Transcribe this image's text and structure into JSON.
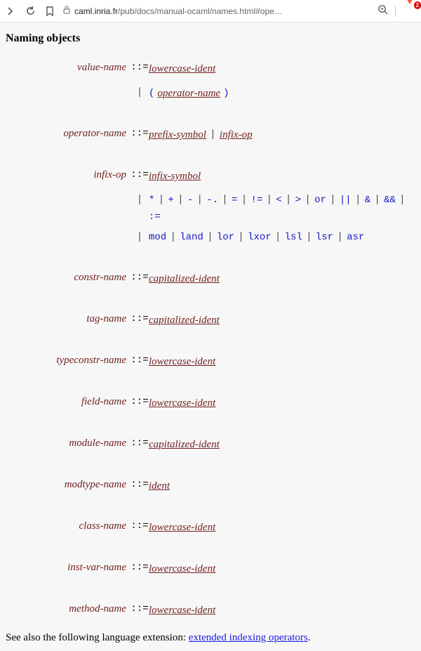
{
  "browser": {
    "url_domain": "caml.inria.fr",
    "url_path": "/pub/docs/manual-ocaml/names.html#ope…",
    "badge": "2"
  },
  "heading": "Naming objects",
  "rules": {
    "value_name": {
      "lhs": "value-name",
      "rhs": [
        "lowercase-ident"
      ]
    },
    "value_name_alt": {
      "paren_open": "(",
      "op": "operator-name",
      "paren_close": ")"
    },
    "operator_name": {
      "lhs": "operator-name",
      "rhs_a": "prefix-symbol",
      "rhs_b": "infix-op"
    },
    "infix_op": {
      "lhs": "infix-op",
      "rhs": "infix-symbol"
    },
    "infix_ops_1": [
      "*",
      "+",
      "-",
      "-.",
      "=",
      "!=",
      "<",
      ">",
      "or",
      "||",
      "&",
      "&&",
      ":="
    ],
    "infix_ops_2": [
      "mod",
      "land",
      "lor",
      "lxor",
      "lsl",
      "lsr",
      "asr"
    ],
    "constr_name": {
      "lhs": "constr-name",
      "rhs": "capitalized-ident"
    },
    "tag_name": {
      "lhs": "tag-name",
      "rhs": "capitalized-ident"
    },
    "typeconstr_name": {
      "lhs": "typeconstr-name",
      "rhs": "lowercase-ident"
    },
    "field_name": {
      "lhs": "field-name",
      "rhs": "lowercase-ident"
    },
    "module_name": {
      "lhs": "module-name",
      "rhs": "capitalized-ident"
    },
    "modtype_name": {
      "lhs": "modtype-name",
      "rhs": "ident"
    },
    "class_name": {
      "lhs": "class-name",
      "rhs": "lowercase-ident"
    },
    "inst_var_name": {
      "lhs": "inst-var-name",
      "rhs": "lowercase-ident"
    },
    "method_name": {
      "lhs": "method-name",
      "rhs": "lowercase-ident"
    }
  },
  "footnote": {
    "prefix": "See also the following language extension: ",
    "link": "extended indexing operators",
    "suffix": "."
  },
  "bnf_op": "::="
}
